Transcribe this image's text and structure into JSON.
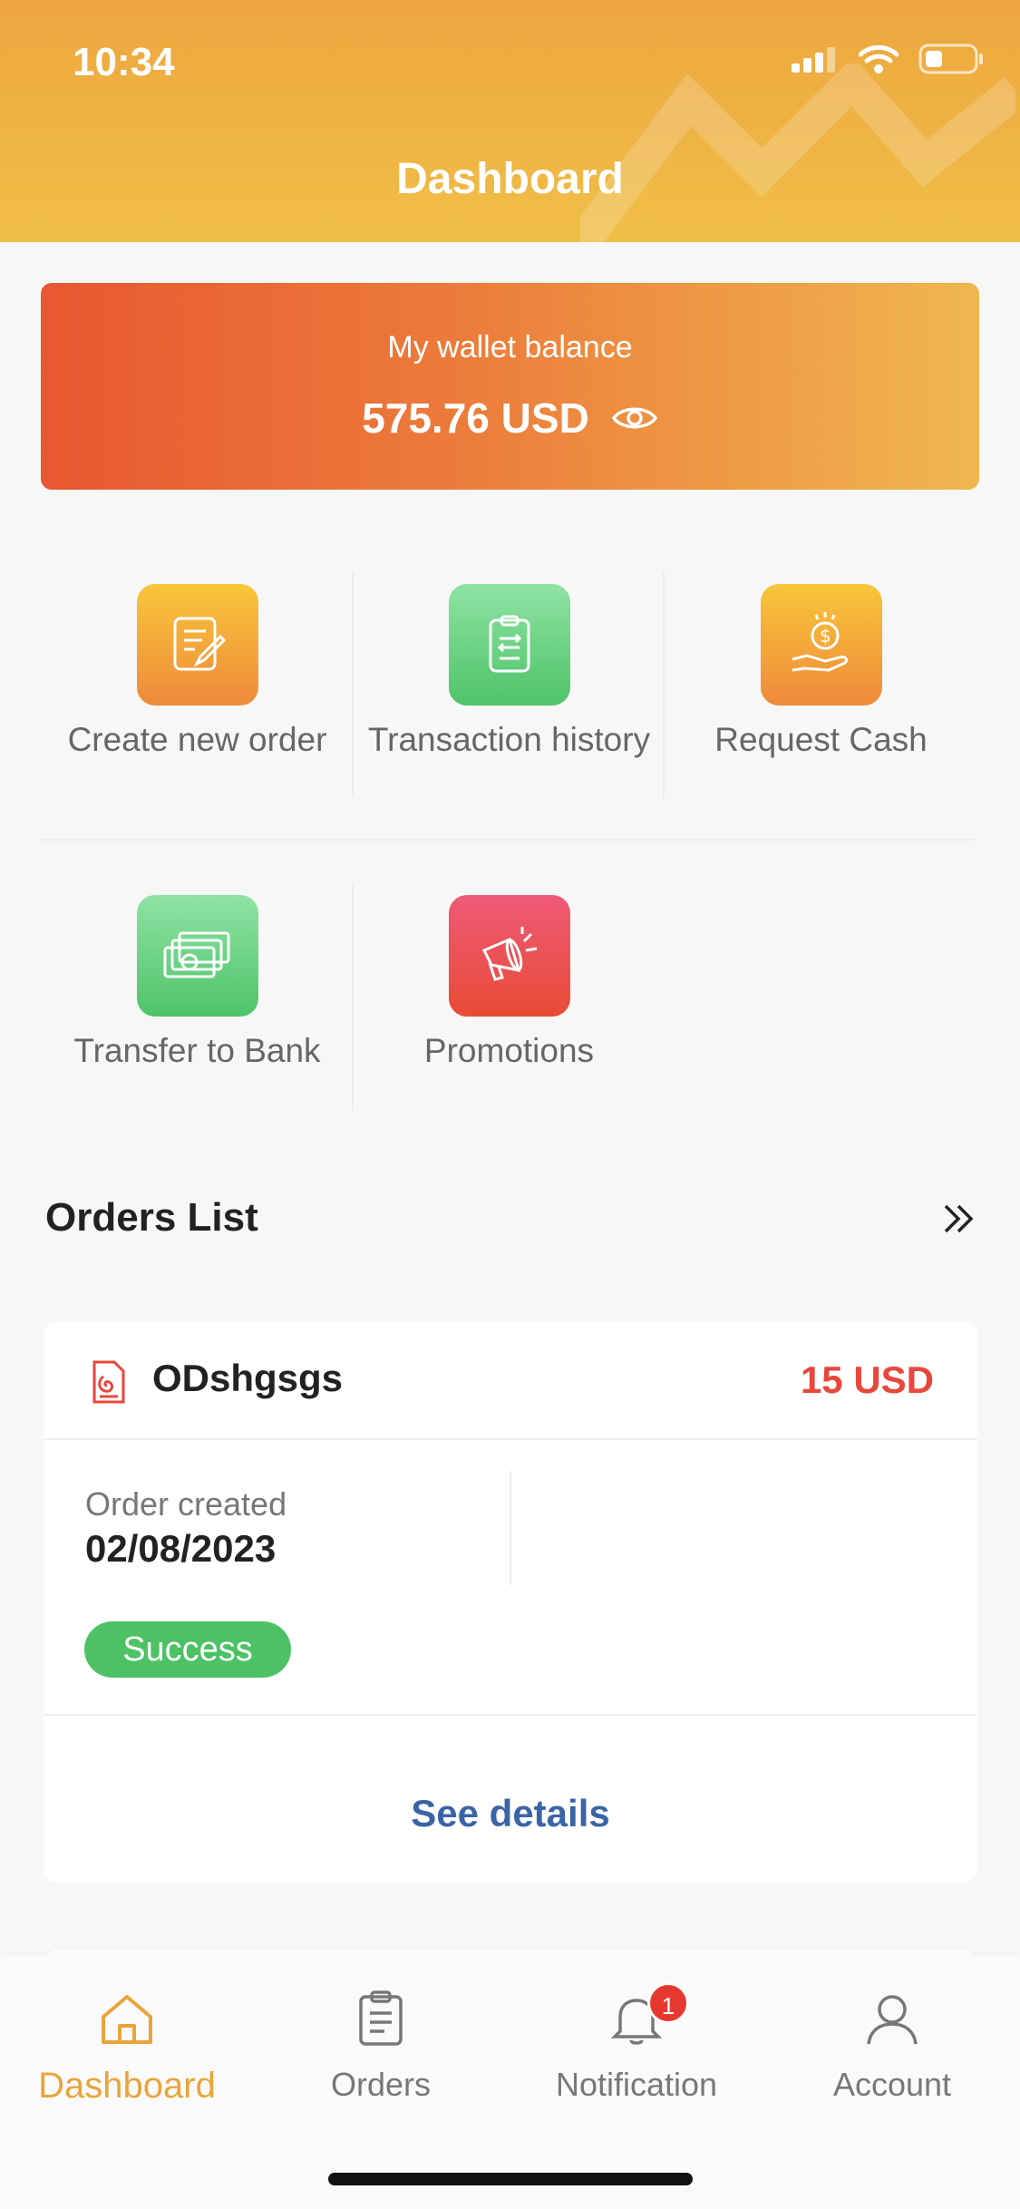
{
  "status_bar": {
    "time": "10:34"
  },
  "header": {
    "title": "Dashboard"
  },
  "wallet": {
    "label": "My wallet balance",
    "amount": "575.76 USD"
  },
  "quick_actions": [
    {
      "label": "Create new order",
      "icon": "create-order-icon"
    },
    {
      "label": "Transaction history",
      "icon": "transaction-history-icon"
    },
    {
      "label": "Request Cash",
      "icon": "request-cash-icon"
    },
    {
      "label": "Transfer to Bank",
      "icon": "transfer-bank-icon"
    },
    {
      "label": "Promotions",
      "icon": "promotions-icon"
    }
  ],
  "orders": {
    "heading": "Orders List",
    "items": [
      {
        "id": "ODshgsgs",
        "price": "15 USD",
        "created_label": "Order created",
        "created_date": "02/08/2023",
        "status": "Success",
        "details_label": "See details"
      }
    ]
  },
  "tabbar": {
    "items": [
      {
        "label": "Dashboard",
        "active": true
      },
      {
        "label": "Orders",
        "active": false
      },
      {
        "label": "Notification",
        "active": false,
        "badge": "1"
      },
      {
        "label": "Account",
        "active": false
      }
    ]
  },
  "colors": {
    "accent": "#e9a53b",
    "price": "#e8473b",
    "success": "#4cc264",
    "link": "#3a64a6"
  }
}
